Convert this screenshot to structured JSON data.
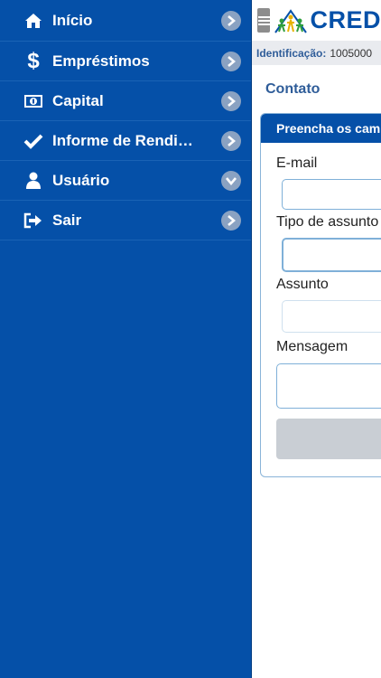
{
  "sidebar": {
    "items": [
      {
        "label": "Início",
        "icon": "home-icon",
        "chevron": "right"
      },
      {
        "label": "Empréstimos",
        "icon": "dollar-icon",
        "chevron": "right"
      },
      {
        "label": "Capital",
        "icon": "money-bill-icon",
        "chevron": "right"
      },
      {
        "label": "Informe de Rendimentos",
        "icon": "checkmark-icon",
        "chevron": "right"
      },
      {
        "label": "Usuário",
        "icon": "user-icon",
        "chevron": "down"
      },
      {
        "label": "Sair",
        "icon": "sign-out-icon",
        "chevron": "right"
      }
    ]
  },
  "header": {
    "logo_text": "CRED"
  },
  "identification": {
    "label": "Identificação:",
    "value": "1005000"
  },
  "page": {
    "title": "Contato"
  },
  "form": {
    "heading": "Preencha os campos",
    "email_label": "E-mail",
    "email_value": "",
    "subject_type_label": "Tipo de assunto",
    "subject_type_value": "",
    "subject_label": "Assunto",
    "subject_value": "",
    "message_label": "Mensagem",
    "message_value": "",
    "submit_label": ""
  },
  "colors": {
    "brand": "#0550a8",
    "chevron_bg": "#8aa2c2",
    "id_bar_bg": "#e9ebef"
  }
}
